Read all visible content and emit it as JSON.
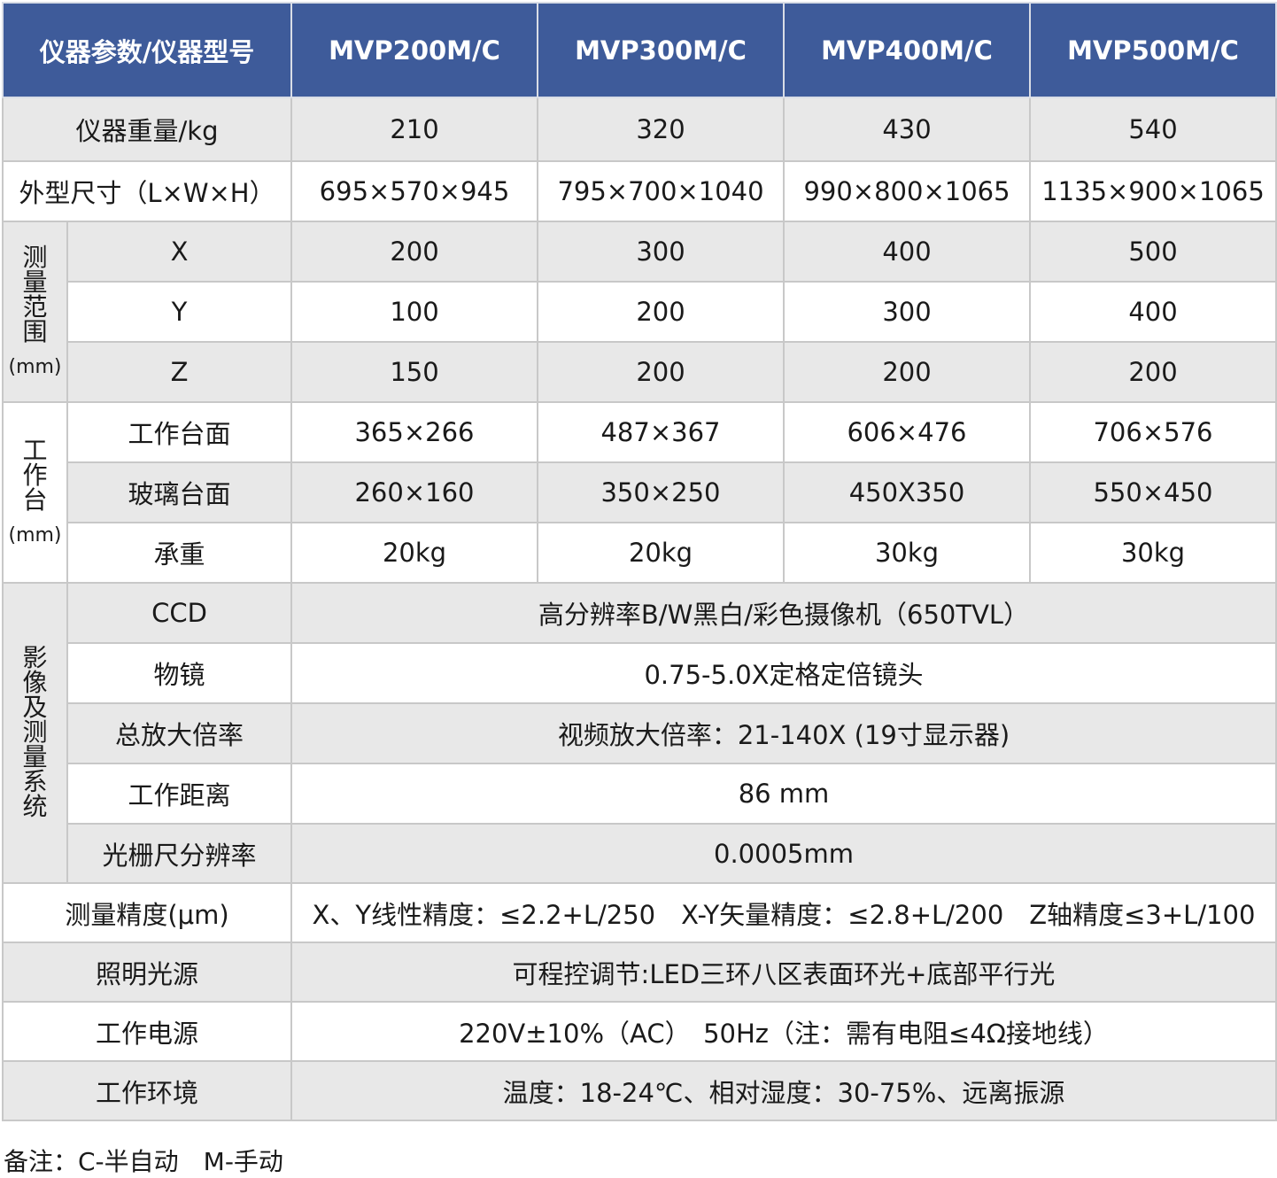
{
  "header": {
    "param_model": "仪器参数/仪器型号",
    "models": [
      "MVP200M/C",
      "MVP300M/C",
      "MVP400M/C",
      "MVP500M/C"
    ]
  },
  "weight": {
    "label": "仪器重量/kg",
    "values": [
      "210",
      "320",
      "430",
      "540"
    ]
  },
  "dimensions": {
    "label": "外型尺寸（L×W×H）",
    "values": [
      "695×570×945",
      "795×700×1040",
      "990×800×1065",
      "1135×900×1065"
    ]
  },
  "measure_range": {
    "group": "测量范围",
    "unit": "(mm)",
    "rows": [
      {
        "label": "X",
        "values": [
          "200",
          "300",
          "400",
          "500"
        ]
      },
      {
        "label": "Y",
        "values": [
          "100",
          "200",
          "300",
          "400"
        ]
      },
      {
        "label": "Z",
        "values": [
          "150",
          "200",
          "200",
          "200"
        ]
      }
    ]
  },
  "worktable": {
    "group": "工作台",
    "unit": "(mm)",
    "rows": [
      {
        "label": "工作台面",
        "values": [
          "365×266",
          "487×367",
          "606×476",
          "706×576"
        ]
      },
      {
        "label": "玻璃台面",
        "values": [
          "260×160",
          "350×250",
          "450X350",
          "550×450"
        ]
      },
      {
        "label": "承重",
        "values": [
          "20kg",
          "20kg",
          "30kg",
          "30kg"
        ]
      }
    ]
  },
  "imaging": {
    "group": "影像及测量系统",
    "rows": [
      {
        "label": "CCD",
        "value": "高分辨率B/W黑白/彩色摄像机（650TVL）"
      },
      {
        "label": "物镜",
        "value": "0.75-5.0X定格定倍镜头"
      },
      {
        "label": "总放大倍率",
        "value": "视频放大倍率：21-140X (19寸显示器)"
      },
      {
        "label": "工作距离",
        "value": "86 mm"
      },
      {
        "label": "光栅尺分辨率",
        "value": "0.0005mm"
      }
    ]
  },
  "accuracy": {
    "label": "测量精度(μm)",
    "value": "X、Y线性精度：≤2.2+L/250　X-Y矢量精度：≤2.8+L/200　Z轴精度≤3+L/100"
  },
  "lighting": {
    "label": "照明光源",
    "value": "可程控调节:LED三环八区表面环光+底部平行光"
  },
  "power": {
    "label": "工作电源",
    "value": "220V±10%（AC）　50Hz（注：需有电阻≤4Ω接地线）"
  },
  "environment": {
    "label": "工作环境",
    "value": "温度：18-24℃、相对湿度：30-75%、远离振源"
  },
  "note": "备注：C-半自动　M-手动",
  "colors": {
    "header_bg": "#3e5b9a",
    "row_gray": "#e8e8e8",
    "border": "#c8c8c8"
  }
}
